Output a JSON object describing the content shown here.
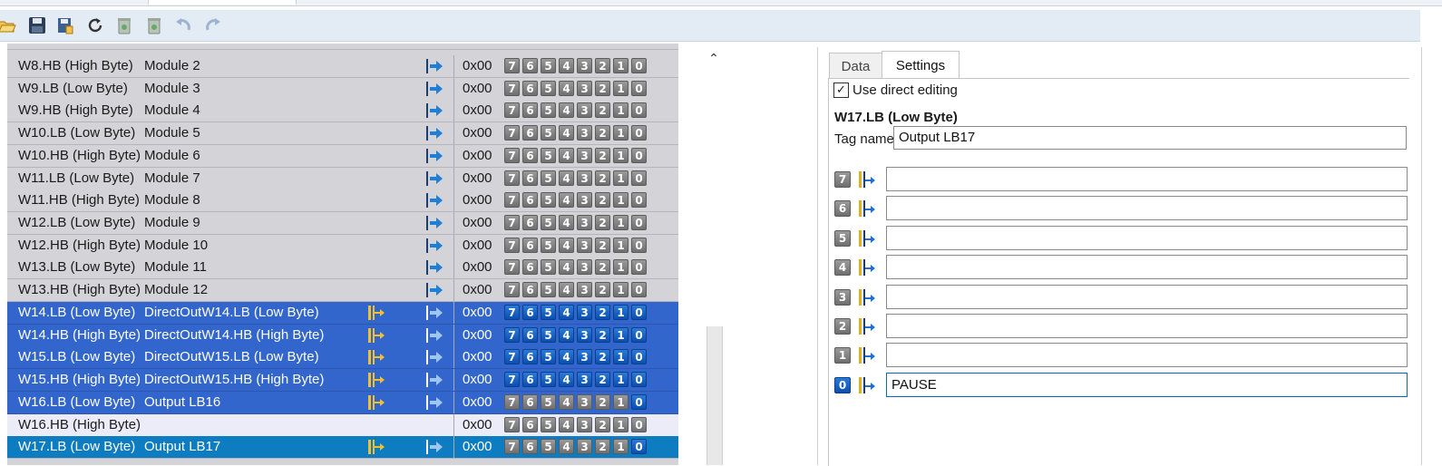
{
  "toolbar": {
    "icons": [
      "open-folder-icon",
      "save-icon",
      "save-as-icon",
      "refresh-icon",
      "delete-icon",
      "delete-all-icon",
      "undo-icon",
      "redo-icon"
    ]
  },
  "grid": {
    "rows": [
      {
        "addr": "W8.HB (High Byte)",
        "name": "Module 2",
        "val": "0x00",
        "state": "normal"
      },
      {
        "addr": "W9.LB (Low Byte)",
        "name": "Module 3",
        "val": "0x00",
        "state": "normal"
      },
      {
        "addr": "W9.HB (High Byte)",
        "name": "Module 4",
        "val": "0x00",
        "state": "normal"
      },
      {
        "addr": "W10.LB (Low Byte)",
        "name": "Module 5",
        "val": "0x00",
        "state": "normal"
      },
      {
        "addr": "W10.HB (High Byte)",
        "name": "Module 6",
        "val": "0x00",
        "state": "normal"
      },
      {
        "addr": "W11.LB (Low Byte)",
        "name": "Module 7",
        "val": "0x00",
        "state": "normal"
      },
      {
        "addr": "W11.HB (High Byte)",
        "name": "Module 8",
        "val": "0x00",
        "state": "normal"
      },
      {
        "addr": "W12.LB (Low Byte)",
        "name": "Module 9",
        "val": "0x00",
        "state": "normal"
      },
      {
        "addr": "W12.HB (High Byte)",
        "name": "Module 10",
        "val": "0x00",
        "state": "normal"
      },
      {
        "addr": "W13.LB (Low Byte)",
        "name": "Module 11",
        "val": "0x00",
        "state": "normal"
      },
      {
        "addr": "W13.HB (High Byte)",
        "name": "Module 12",
        "val": "0x00",
        "state": "normal"
      },
      {
        "addr": "W14.LB (Low Byte)",
        "name": "DirectOutW14.LB (Low Byte)",
        "val": "0x00",
        "state": "sel",
        "bitsOn": true
      },
      {
        "addr": "W14.HB (High Byte)",
        "name": "DirectOutW14.HB (High Byte)",
        "val": "0x00",
        "state": "sel",
        "bitsOn": true
      },
      {
        "addr": "W15.LB (Low Byte)",
        "name": "DirectOutW15.LB (Low Byte)",
        "val": "0x00",
        "state": "sel",
        "bitsOn": true
      },
      {
        "addr": "W15.HB (High Byte)",
        "name": "DirectOutW15.HB (High Byte)",
        "val": "0x00",
        "state": "sel",
        "bitsOn": true
      },
      {
        "addr": "W16.LB (Low Byte)",
        "name": "Output LB16",
        "val": "0x00",
        "state": "sel",
        "bitsOn": false,
        "bit0On": true
      },
      {
        "addr": "W16.HB (High Byte)",
        "name": "",
        "val": "0x00",
        "state": "light"
      },
      {
        "addr": "W17.LB (Low Byte)",
        "name": "Output LB17",
        "val": "0x00",
        "state": "cur",
        "bit0On": true
      }
    ],
    "bit_labels": [
      "7",
      "6",
      "5",
      "4",
      "3",
      "2",
      "1",
      "0"
    ]
  },
  "panel": {
    "tabs": {
      "data": "Data",
      "settings": "Settings"
    },
    "use_direct_editing": "Use direct editing",
    "use_direct_editing_checked": true,
    "section_title": "W17.LB (Low Byte)",
    "tag_name_label": "Tag name",
    "tag_name_value": "Output LB17",
    "bits": [
      {
        "bit": "7",
        "value": ""
      },
      {
        "bit": "6",
        "value": ""
      },
      {
        "bit": "5",
        "value": ""
      },
      {
        "bit": "4",
        "value": ""
      },
      {
        "bit": "3",
        "value": ""
      },
      {
        "bit": "2",
        "value": ""
      },
      {
        "bit": "1",
        "value": ""
      },
      {
        "bit": "0",
        "value": "PAUSE",
        "active": true
      }
    ]
  }
}
